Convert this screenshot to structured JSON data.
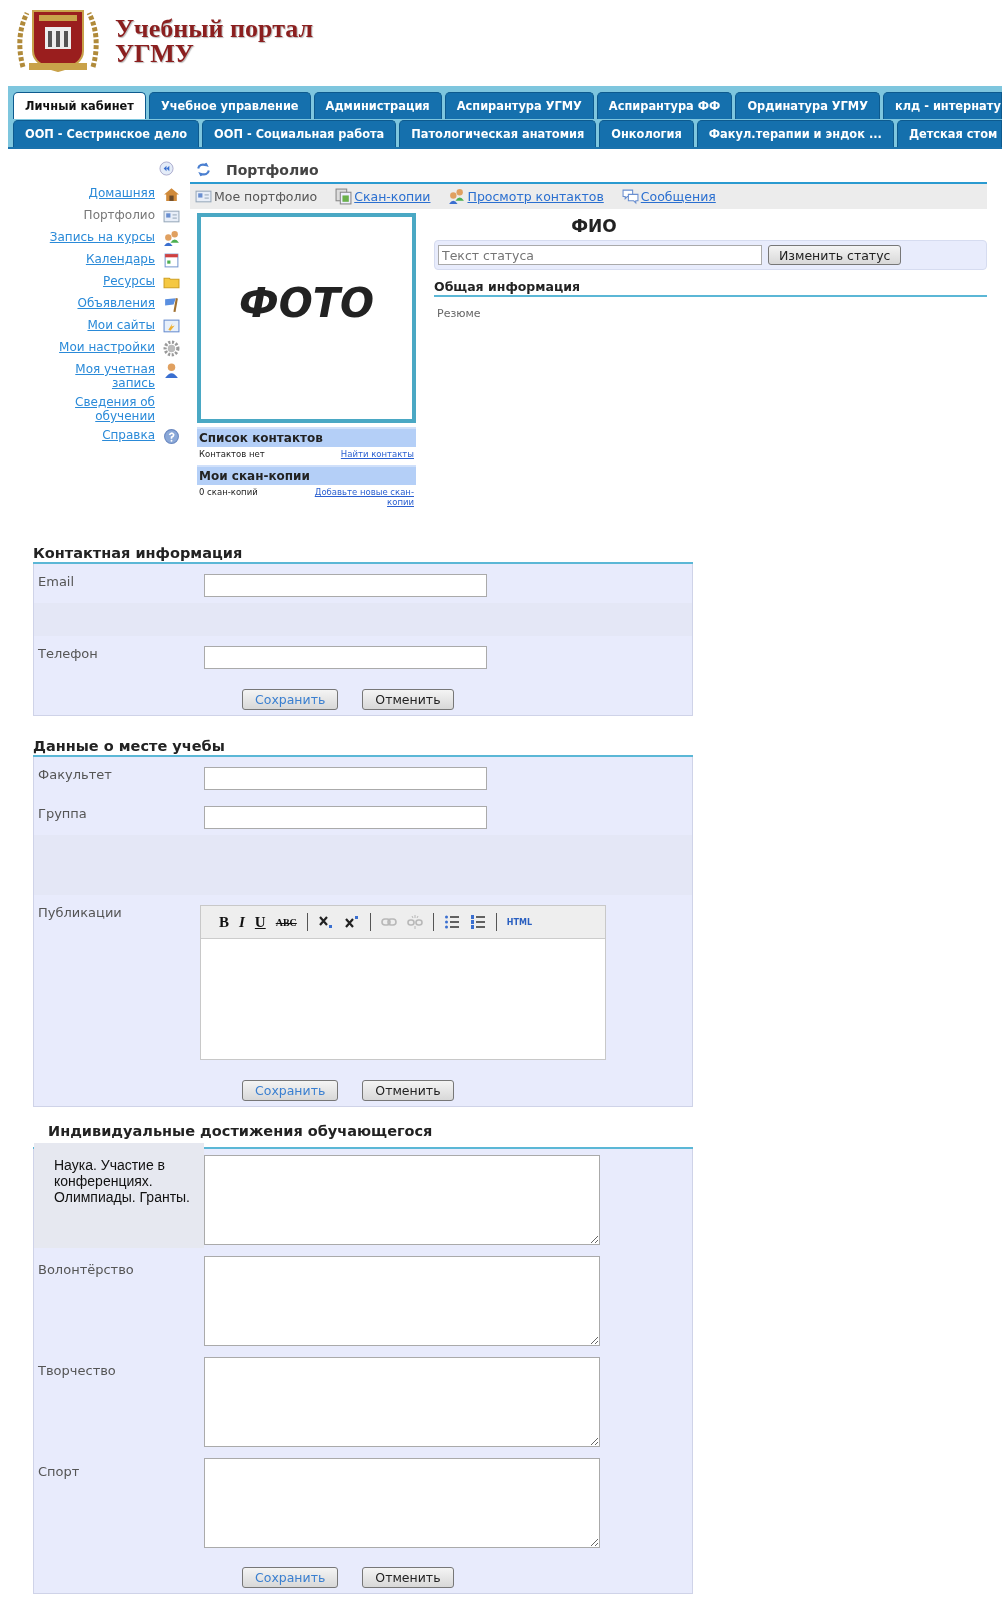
{
  "header": {
    "title_lines": [
      "Учебный портал",
      "УГМУ"
    ]
  },
  "tabs": [
    [
      {
        "label": "Личный кабинет",
        "selected": true
      },
      {
        "label": "Учебное управление",
        "selected": false
      },
      {
        "label": "Администрация",
        "selected": false
      },
      {
        "label": "Аспирантура УГМУ",
        "selected": false
      },
      {
        "label": "Аспирантура ФФ",
        "selected": false
      },
      {
        "label": "Ординатура УГМУ",
        "selected": false
      },
      {
        "label": "клд - интернату",
        "selected": false
      }
    ],
    [
      {
        "label": "ООП - Сестринское дело",
        "selected": false
      },
      {
        "label": "ООП - Социальная работа",
        "selected": false
      },
      {
        "label": "Патологическая анатомия",
        "selected": false
      },
      {
        "label": "Онкология",
        "selected": false
      },
      {
        "label": "Факул.терапии и эндок ...",
        "selected": false
      },
      {
        "label": "Детская стом",
        "selected": false
      }
    ]
  ],
  "sidebar": {
    "items": [
      {
        "label": "Домашняя",
        "kind": "home",
        "selected": false
      },
      {
        "label": "Портфолио",
        "kind": "card",
        "selected": true
      },
      {
        "label": "Запись на курсы",
        "kind": "people",
        "selected": false
      },
      {
        "label": "Календарь",
        "kind": "calendar",
        "selected": false
      },
      {
        "label": "Ресурсы",
        "kind": "folder",
        "selected": false
      },
      {
        "label": "Объявления",
        "kind": "flag",
        "selected": false
      },
      {
        "label": "Мои сайты",
        "kind": "screen",
        "selected": false
      },
      {
        "label": "Мои настройки",
        "kind": "gear",
        "selected": false
      },
      {
        "label": "Моя учетная запись",
        "kind": "person",
        "selected": false
      },
      {
        "label": "Сведения об обучении",
        "kind": "none",
        "selected": false
      },
      {
        "label": "Справка",
        "kind": "help",
        "selected": false
      }
    ]
  },
  "portfolio": {
    "title": "Портфолио",
    "toolbar": [
      {
        "label": "Мое портфолио",
        "kind": "card",
        "selected": true
      },
      {
        "label": "Скан-копии",
        "kind": "copies",
        "selected": false
      },
      {
        "label": "Просмотр контактов",
        "kind": "people",
        "selected": false
      },
      {
        "label": "Сообщения",
        "kind": "chat",
        "selected": false
      }
    ],
    "photo_label": "ФОТО",
    "name": "ФИО",
    "status": {
      "placeholder": "Текст статуса",
      "button": "Изменить статус"
    },
    "general_heading": "Общая информация",
    "resume": "Резюме",
    "contacts": {
      "heading": "Список контактов",
      "text": "Контактов нет",
      "link": "Найти контакты"
    },
    "scans": {
      "heading": "Мои скан-копии",
      "text": "0 скан-копий",
      "link": "Добавьте новые скан-копии"
    }
  },
  "sections": [
    {
      "heading": "Контактная информация",
      "rows": [
        {
          "kind": "input",
          "label": "Email"
        },
        {
          "kind": "spacer"
        },
        {
          "kind": "input",
          "label": "Телефон"
        }
      ],
      "buttons": [
        {
          "label": "Сохранить",
          "kind": "save"
        },
        {
          "label": "Отменить",
          "kind": "cancel"
        }
      ]
    },
    {
      "heading": "Данные о месте учебы",
      "rows": [
        {
          "kind": "input",
          "label": "Факультет"
        },
        {
          "kind": "input",
          "label": "Группа"
        },
        {
          "kind": "spacer"
        },
        {
          "kind": "editor",
          "label": "Публикации",
          "toolbar": [
            {
              "kind": "bold",
              "label": "B"
            },
            {
              "kind": "italic",
              "label": "I"
            },
            {
              "kind": "underline",
              "label": "U"
            },
            {
              "kind": "strike",
              "label": "ABC"
            },
            {
              "kind": "separator"
            },
            {
              "kind": "subscript"
            },
            {
              "kind": "superscript"
            },
            {
              "kind": "separator"
            },
            {
              "kind": "link",
              "disabled": true
            },
            {
              "kind": "unlink",
              "disabled": true
            },
            {
              "kind": "separator"
            },
            {
              "kind": "bullets"
            },
            {
              "kind": "numbers"
            },
            {
              "kind": "separator"
            },
            {
              "kind": "html",
              "label": "HTML"
            }
          ]
        }
      ],
      "buttons": [
        {
          "label": "Сохранить",
          "kind": "save"
        },
        {
          "label": "Отменить",
          "kind": "cancel"
        }
      ]
    },
    {
      "heading": "Индивидуальные достижения обучающегося",
      "indented_heading": true,
      "rows": [
        {
          "kind": "textarea",
          "label": "Наука. Участие в конференциях. Олимпиады. Гранты.",
          "emphasized": true
        },
        {
          "kind": "textarea",
          "label": "Волонтёрство",
          "emphasized": false
        },
        {
          "kind": "textarea",
          "label": "Творчество",
          "emphasized": false
        },
        {
          "kind": "textarea",
          "label": "Спорт",
          "emphasized": false
        }
      ],
      "buttons": [
        {
          "label": "Сохранить",
          "kind": "save"
        },
        {
          "label": "Отменить",
          "kind": "cancel"
        }
      ]
    }
  ]
}
